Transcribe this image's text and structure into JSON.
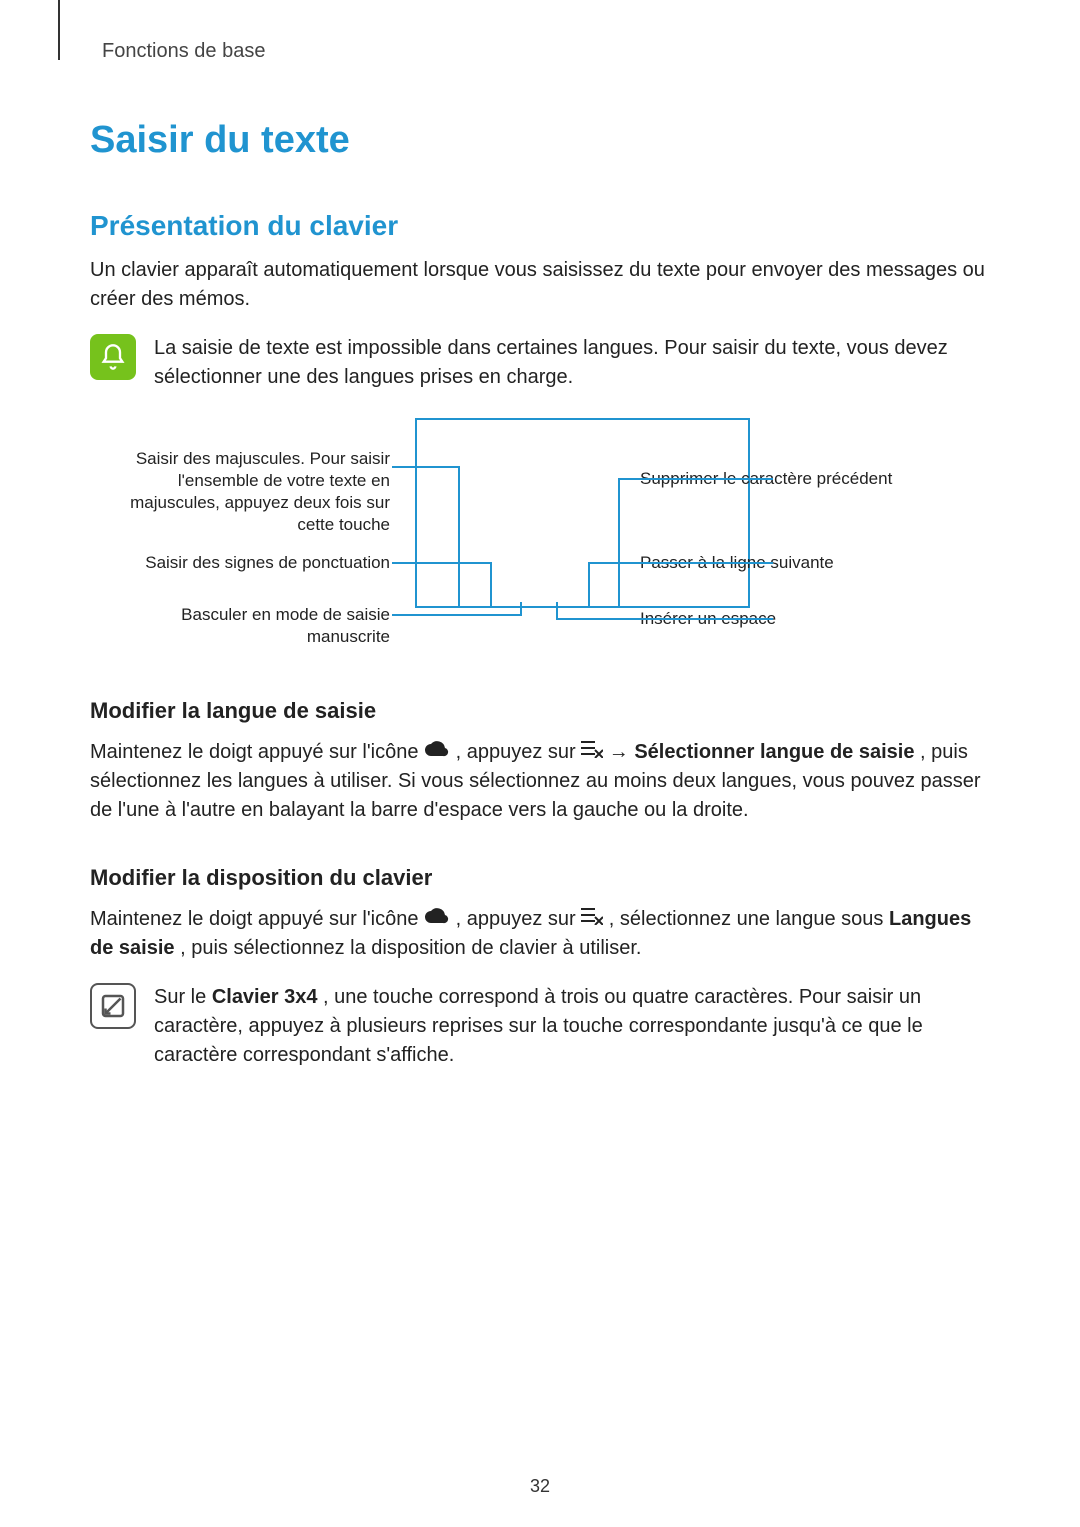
{
  "header": {
    "section": "Fonctions de base"
  },
  "title": "Saisir du texte",
  "h2_1": "Présentation du clavier",
  "p1": "Un clavier apparaît automatiquement lorsque vous saisissez du texte pour envoyer des messages ou créer des mémos.",
  "note1": "La saisie de texte est impossible dans certaines langues. Pour saisir du texte, vous devez sélectionner une des langues prises en charge.",
  "diagram": {
    "left": {
      "caps": "Saisir des majuscules. Pour saisir l'ensemble de votre texte en majuscules, appuyez deux fois sur cette touche",
      "punct": "Saisir des signes de ponctuation",
      "hand": "Basculer en mode de saisie manuscrite"
    },
    "right": {
      "del": "Supprimer le caractère précédent",
      "enter": "Passer à la ligne suivante",
      "space": "Insérer un espace"
    }
  },
  "h3_1": "Modifier la langue de saisie",
  "p2_pre": "Maintenez le doigt appuyé sur l'icône ",
  "p2_mid": ", appuyez sur ",
  "p2_arrow": " → ",
  "p2_bold": "Sélectionner langue de saisie",
  "p2_post": ", puis sélectionnez les langues à utiliser. Si vous sélectionnez au moins deux langues, vous pouvez passer de l'une à l'autre en balayant la barre d'espace vers la gauche ou la droite.",
  "h3_2": "Modifier la disposition du clavier",
  "p3_pre": "Maintenez le doigt appuyé sur l'icône ",
  "p3_mid": ", appuyez sur ",
  "p3_mid2": ", sélectionnez une langue sous ",
  "p3_bold": "Langues de saisie",
  "p3_post": ", puis sélectionnez la disposition de clavier à utiliser.",
  "note2_pre": "Sur le ",
  "note2_bold": "Clavier 3x4",
  "note2_post": ", une touche correspond à trois ou quatre caractères. Pour saisir un caractère, appuyez à plusieurs reprises sur la touche correspondante jusqu'à ce que le caractère correspondant s'affiche.",
  "page": "32"
}
